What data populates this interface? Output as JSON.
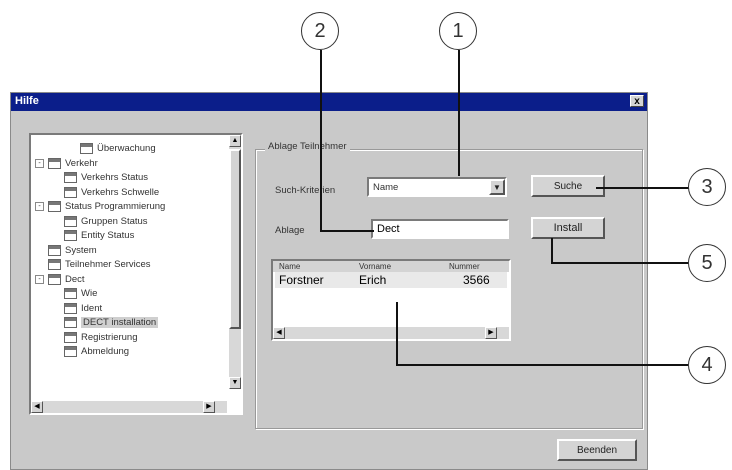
{
  "window": {
    "title": "Hilfe",
    "close_glyph": "x"
  },
  "tree": {
    "items": [
      {
        "label": "Überwachung",
        "indent": 3,
        "icon": "folder-icon"
      },
      {
        "label": "Verkehr",
        "indent": 1,
        "icon": "folder-icon",
        "toggle": "-"
      },
      {
        "label": "Verkehrs Status",
        "indent": 2,
        "icon": "folder-icon"
      },
      {
        "label": "Verkehrs Schwelle",
        "indent": 2,
        "icon": "folder-icon"
      },
      {
        "label": "Status Programmierung",
        "indent": 1,
        "icon": "folder-icon",
        "toggle": "-"
      },
      {
        "label": "Gruppen Status",
        "indent": 2,
        "icon": "folder-icon"
      },
      {
        "label": "Entity Status",
        "indent": 2,
        "icon": "folder-icon"
      },
      {
        "label": "System",
        "indent": 1,
        "icon": "folder-icon"
      },
      {
        "label": "Teilnehmer Services",
        "indent": 1,
        "icon": "folder-icon"
      },
      {
        "label": "Dect",
        "indent": 1,
        "icon": "folder-icon",
        "toggle": "-"
      },
      {
        "label": "Wie",
        "indent": 2,
        "icon": "folder-icon"
      },
      {
        "label": "Ident",
        "indent": 2,
        "icon": "folder-icon"
      },
      {
        "label": "DECT installation",
        "indent": 2,
        "icon": "folder-icon",
        "selected": true
      },
      {
        "label": "Registrierung",
        "indent": 2,
        "icon": "folder-icon"
      },
      {
        "label": "Abmeldung",
        "indent": 2,
        "icon": "folder-icon"
      }
    ]
  },
  "panel": {
    "group_title": "Ablage Teilnehmer",
    "search_criteria_label": "Such-Kriterien",
    "search_criteria_value": "Name",
    "search_button": "Suche",
    "ablage_label": "Ablage",
    "ablage_value": "Dect",
    "install_button": "Install",
    "table": {
      "columns": [
        "Name",
        "Vorname",
        "Nummer"
      ],
      "rows": [
        {
          "name": "Forstner",
          "vorname": "Erich",
          "nummer": "3566"
        }
      ]
    },
    "exit_button": "Beenden"
  },
  "callouts": [
    "1",
    "2",
    "3",
    "4",
    "5"
  ]
}
